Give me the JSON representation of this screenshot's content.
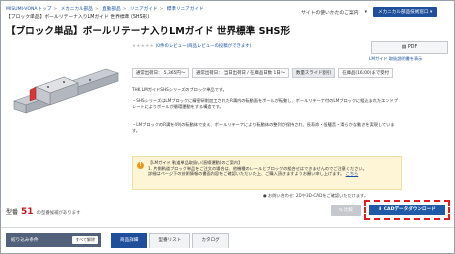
{
  "breadcrumb": {
    "items": [
      "MISUMI-VONAトップ",
      "メカニカル部品",
      "直動部品",
      "リニアガイド",
      "標準リニアガイド"
    ]
  },
  "part_code": "【ブロック単品】ボールリテーナ入りLMガイド 世界標準 (SHS形)",
  "top_nav": {
    "list_link": "サイトの使いかたのご案内",
    "dropdown_label": "メカニカル部品技術窓口"
  },
  "product": {
    "title": "【ブロック単品】ボールリテーナ入りLMガイド 世界標準 SHS形",
    "review_text": "(0件のレビュー(商品レビューの投稿ができます)",
    "stars": "★★★★★"
  },
  "specs": [
    {
      "label": "通常出荷日：",
      "value": "5,365円〜"
    },
    {
      "label": "通常出荷日：",
      "value": "当日出荷日 / 在庫品日数 1日〜"
    },
    {
      "label": "",
      "value": "数量スライド割引"
    },
    {
      "label": "",
      "value": "在庫品(16:00)まで受付"
    }
  ],
  "description": {
    "intro": "THK LMガイドSHSシリーズのブロック単品です。",
    "bullet1": "・SHSシリーズはLMブロックに精密研削加工されたR溝内の転動面をボールが転動し、ボールリテーナ付のLMブロックに組込まれたエンドプレートによりボールが循環運動をする構造です。",
    "bullet2": "・LMブロックのR溝を4列の転動体で支え、ボールリテーナにより転動体の整列が保持され、長寿命・低騒音・滑らかな動きを実現しています。"
  },
  "notice": {
    "heading": "【LMガイド 軌道単品取扱い(直線運動)のご案内】",
    "line1": "1. 片側軌道ブロック単品をご注文の場合は、他機種のレールとブロックの組合せはできませんのでご注意ください。",
    "line2": "詳細はページ下の技術情報の書面内容をご確認いただいた上、ご購入頂きますようお願い申し上げます。",
    "link": "こちら"
  },
  "right_panel": {
    "pdf_label": "PDF",
    "pdf_link": "LMガイド 取扱説明書を表示"
  },
  "related_note": "お問い合わせ: 2Dや3D-CADをご確認いただけます。",
  "count": {
    "prefix": "型番",
    "number": "51",
    "suffix": "の型番候補があります"
  },
  "buttons": {
    "grey": "比較",
    "cad": "CADデータダウンロード"
  },
  "filter": {
    "title": "絞り込み条件",
    "clear": "すべて解除"
  },
  "tabs": [
    "商品詳細",
    "型番リスト",
    "カタログ"
  ],
  "colors": {
    "accent_blue": "#1f4f9a",
    "cad_button": "#1f5aa8",
    "highlight_red": "#e01b22",
    "notice_bg": "#fdf5d6"
  }
}
